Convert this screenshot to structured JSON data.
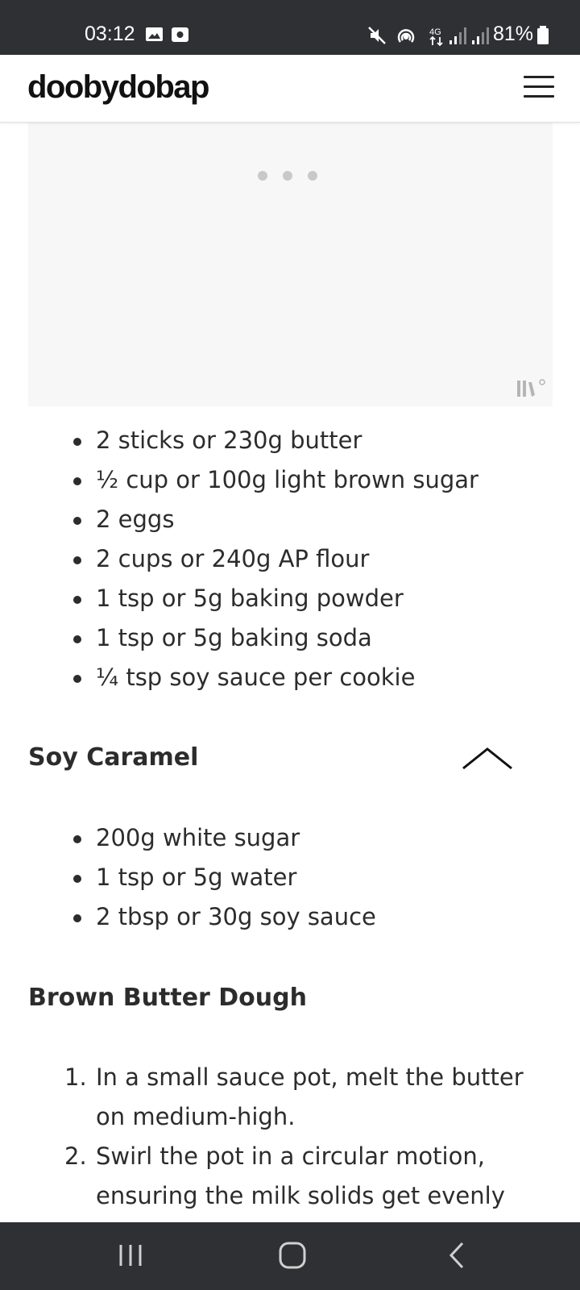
{
  "status_bar": {
    "time": "03:12",
    "battery": "81%",
    "icons": [
      "gallery-icon",
      "screen-record-icon",
      "mute-icon",
      "hotspot-icon",
      "4g-icon",
      "signal-icon",
      "signal-icon",
      "battery-icon"
    ]
  },
  "header": {
    "logo": "doobydobap",
    "menu_icon": "hamburger-menu-icon"
  },
  "ingredients": {
    "dough_items": [
      "2 sticks or 230g butter",
      "½ cup or 100g light brown sugar",
      "2 eggs",
      "2 cups or 240g AP flour",
      "1 tsp or 5g baking powder",
      "1 tsp or 5g baking soda",
      "¼ tsp soy sauce per cookie"
    ],
    "caramel": {
      "heading": "Soy Caramel",
      "toggle_icon": "chevron-up-icon",
      "items": [
        "200g white sugar",
        "1 tsp or 5g water",
        "2 tbsp or 30g soy sauce"
      ]
    }
  },
  "instructions": {
    "heading": "Brown Butter Dough",
    "steps": [
      {
        "num": "1.",
        "text": "In a small sauce pot, melt the butter on medium-high."
      },
      {
        "num": "2.",
        "text": "Swirl the pot in a circular motion, ensuring the milk solids get evenly"
      }
    ]
  },
  "nav_bar": {
    "icons": [
      "recent-apps-icon",
      "home-icon",
      "back-icon"
    ]
  },
  "colors": {
    "system_bar": "#2f3034",
    "text": "#2c2c2c",
    "media_bg": "#f7f7f7"
  }
}
